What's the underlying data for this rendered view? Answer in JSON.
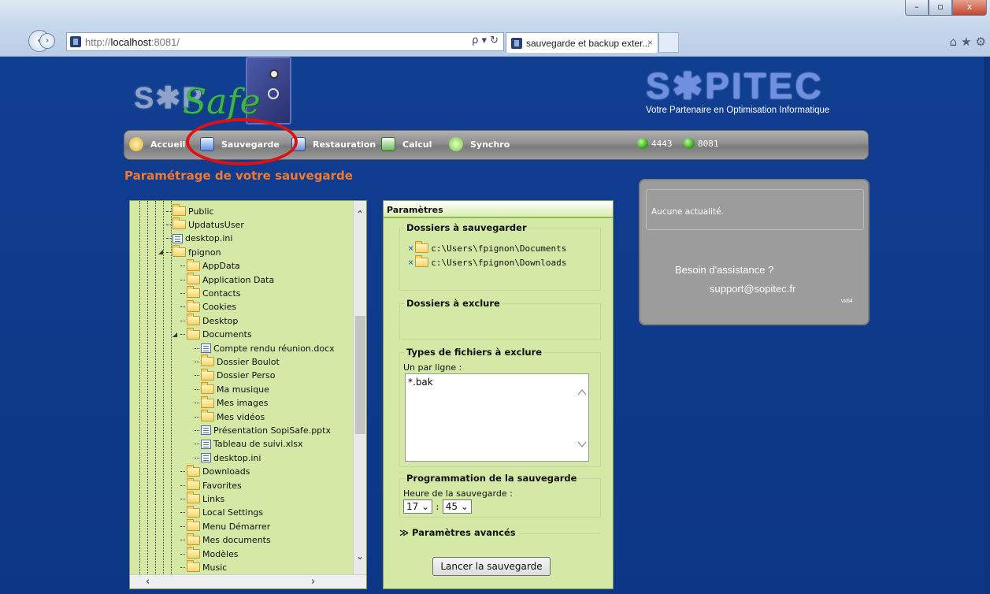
{
  "browser": {
    "url_prefix": "http://",
    "url_host": "localhost",
    "url_suffix": ":8081/",
    "addr_tools": "ρ ▾ ↻",
    "tab_title": "sauvegarde et backup exter...",
    "tab_close": "×",
    "back": "‹",
    "forward": "›",
    "win_min": "–",
    "win_max": "▫",
    "win_close": "x",
    "toolbar_icons": "⌂★⚙"
  },
  "nav": {
    "items": [
      {
        "label": "Accueil",
        "icon": "home-icon"
      },
      {
        "label": "Sauvegarde",
        "icon": "backup-icon"
      },
      {
        "label": "Restauration",
        "icon": "restore-icon"
      },
      {
        "label": "Calcul",
        "icon": "calculator-icon"
      },
      {
        "label": "Synchro",
        "icon": "sync-icon"
      }
    ],
    "ports": [
      "4443",
      "8081"
    ],
    "active": "Sauvegarde",
    "highlight_color": "#e11010"
  },
  "logos": {
    "left_sop": "S✱P",
    "left_safe": "Safe",
    "right_name": "S✱PITEC",
    "right_tagline": "Votre Partenaire en Optimisation Informatique"
  },
  "page": {
    "title": "Paramétrage de votre sauvegarde"
  },
  "tree": {
    "items": [
      {
        "label": "Public",
        "type": "folder"
      },
      {
        "label": "UpdatusUser",
        "type": "folder"
      },
      {
        "label": "desktop.ini",
        "type": "file"
      },
      {
        "label": "fpignon",
        "type": "folder",
        "expanded": true
      },
      {
        "label": "AppData",
        "type": "folder"
      },
      {
        "label": "Application Data",
        "type": "folder"
      },
      {
        "label": "Contacts",
        "type": "folder"
      },
      {
        "label": "Cookies",
        "type": "folder"
      },
      {
        "label": "Desktop",
        "type": "folder"
      },
      {
        "label": "Documents",
        "type": "folder",
        "expanded": true
      },
      {
        "label": "Compte rendu réunion.docx",
        "type": "file"
      },
      {
        "label": "Dossier Boulot",
        "type": "folder"
      },
      {
        "label": "Dossier Perso",
        "type": "folder"
      },
      {
        "label": "Ma musique",
        "type": "folder"
      },
      {
        "label": "Mes images",
        "type": "folder"
      },
      {
        "label": "Mes vidéos",
        "type": "folder"
      },
      {
        "label": "Présentation SopiSafe.pptx",
        "type": "file"
      },
      {
        "label": "Tableau de suivi.xlsx",
        "type": "file"
      },
      {
        "label": "desktop.ini",
        "type": "file"
      },
      {
        "label": "Downloads",
        "type": "folder"
      },
      {
        "label": "Favorites",
        "type": "folder"
      },
      {
        "label": "Links",
        "type": "folder"
      },
      {
        "label": "Local Settings",
        "type": "folder"
      },
      {
        "label": "Menu Démarrer",
        "type": "folder"
      },
      {
        "label": "Mes documents",
        "type": "folder"
      },
      {
        "label": "Modèles",
        "type": "folder"
      },
      {
        "label": "Music",
        "type": "folder"
      }
    ]
  },
  "params": {
    "title": "Paramètres",
    "backup_folders": {
      "legend": "Dossiers à sauvegarder",
      "items": [
        "c:\\Users\\fpignon\\Documents",
        "c:\\Users\\fpignon\\Downloads"
      ],
      "remove_symbol": "×"
    },
    "exclude_folders": {
      "legend": "Dossiers à exclure"
    },
    "exclude_types": {
      "legend": "Types de fichiers à exclure",
      "hint": "Un par ligne :",
      "value": "*.bak"
    },
    "schedule": {
      "legend": "Programmation de la sauvegarde",
      "label": "Heure de la sauvegarde :",
      "hour": "17",
      "sep": ":",
      "minute": "45"
    },
    "advanced": "Paramètres avancés",
    "launch_button": "Lancer la sauvegarde"
  },
  "news": {
    "text": "Aucune actualité.",
    "help": "Besoin d'assistance ?",
    "email": "support@sopitec.fr",
    "version": "vx64"
  }
}
